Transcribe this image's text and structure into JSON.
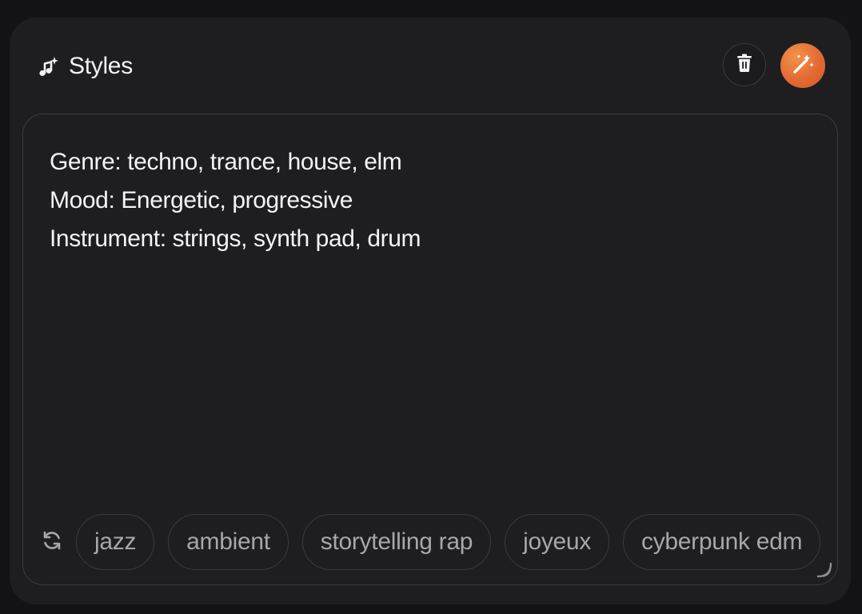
{
  "header": {
    "title": "Styles",
    "title_icon": "music-note-sparkle-icon"
  },
  "actions": {
    "delete_icon": "trash-icon",
    "magic_icon": "magic-wand-icon",
    "magic_color": "#e46a33"
  },
  "editor": {
    "lines": [
      "Genre: techno, trance, house, elm",
      "Mood: Energetic, progressive",
      "Instrument: strings, synth pad, drum"
    ]
  },
  "suggestions": {
    "refresh_icon": "refresh-icon",
    "chips": [
      "jazz",
      "ambient",
      "storytelling rap",
      "joyeux",
      "cyberpunk edm"
    ]
  }
}
